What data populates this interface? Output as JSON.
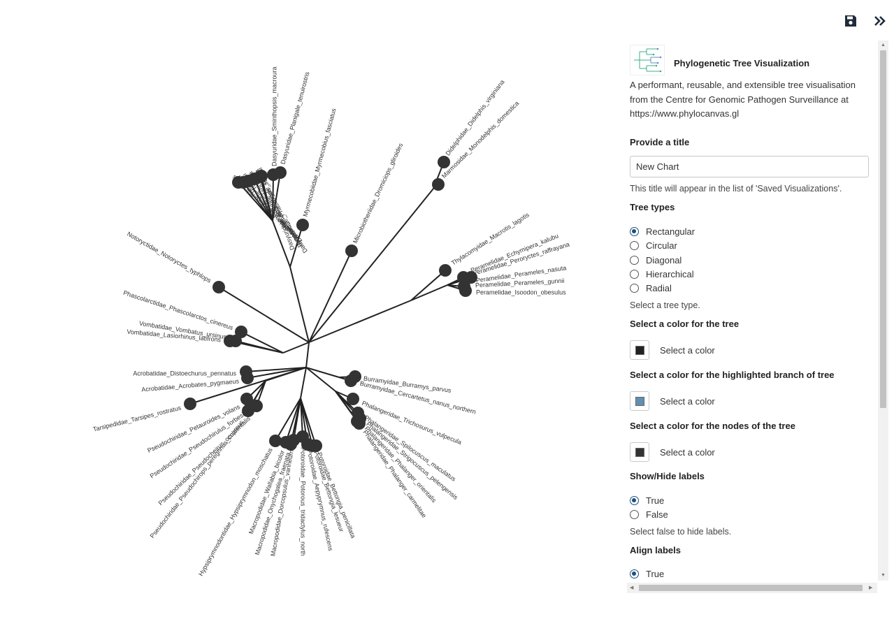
{
  "toolbar": {
    "save_icon": "save-icon",
    "collapse_icon": "chevrons-right-icon"
  },
  "colors": {
    "tree_color": "#222222",
    "highlight_color": "#5f90b4",
    "node_color": "#333333",
    "accent": "#1d4f7c"
  },
  "panel": {
    "title": "Phylogenetic Tree Visualization",
    "description": "A performant, reusable, and extensible tree visualisation from the Centre for Genomic Pathogen Surveillance at",
    "link": "https://www.phylocanvas.gl",
    "title_section": {
      "label": "Provide a title",
      "value": "New Chart",
      "hint": "This title will appear in the list of 'Saved Visualizations'."
    },
    "tree_types": {
      "label": "Tree types",
      "options": [
        "Rectangular",
        "Circular",
        "Diagonal",
        "Hierarchical",
        "Radial"
      ],
      "selected": "Rectangular",
      "hint": "Select a tree type."
    },
    "tree_color": {
      "label": "Select a color for the tree",
      "button": "Select a color"
    },
    "highlight_color": {
      "label": "Select a color for the highlighted branch of tree",
      "button": "Select a color"
    },
    "node_color": {
      "label": "Select a color for the nodes of the tree",
      "button": "Select a color"
    },
    "show_labels": {
      "label": "Show/Hide labels",
      "options": [
        "True",
        "False"
      ],
      "selected": "True",
      "hint": "Select false to hide labels."
    },
    "align_labels": {
      "label": "Align labels",
      "options": [
        "True"
      ],
      "selected": "True"
    }
  },
  "tree": {
    "leaves": [
      "Dasyuridae_Dasyurus_maculatus",
      "Dasyuridae_Dasyurus_geoffroii",
      "Dasyuridae_Sarcophilus_harrisii",
      "Dasyuridae_Phascogale_tapoatafa",
      "Dasyuridae_Phascogale_calura",
      "Dasyuridae_Antechinus_stuartii",
      "Dasyuridae_Sminthopsis_macroura",
      "Dasyuridae_Planigale_tenuirostris",
      "Myrmecobiidae_Myrmecobius_fasciatus",
      "Microbiotheriidae_Dromiciops_gliroides",
      "Didelphidae_Didelphis_virginiana",
      "Marmosidae_Monodelphis_domestica",
      "Thylacomyidae_Macrotis_lagotis",
      "Peramelidae_Echymipera_kalubu",
      "Peramelidae_Peroryctes_raffrayana",
      "Peramelidae_Perameles_nasuta",
      "Peramelidae_Perameles_gunnii",
      "Peramelidae_Isoodon_obesulus",
      "Notoryctidae_Notoryctes_typhlops",
      "Phascolarctidae_Phascolarctos_cinereus",
      "Vombatidae_Vombatus_ursinus",
      "Vombatidae_Lasiorhinus_latifrons",
      "Acrobatidae_Distoechurus_pennatus",
      "Acrobatidae_Acrobates_pygmaeus",
      "Tarsipedidae_Tarsipes_rostratus",
      "Pseudochiridae_Petauroides_volans",
      "Pseudochiridae_Pseudochirulus_forbesi",
      "Pseudochiridae_Pseudocheirus_occidentalis",
      "Pseudochiridae_Pseudochirops_peregrinus_cupreus",
      "Hypsiprymnodontidae_Hypsiprymnodon_moschatus",
      "Macropodidae_Wallabia_bicolor",
      "Macropodidae_Onychogalea_fraenata",
      "Macropodidae_Dorcopsulus_vanheurni",
      "Potoroidae_Potorous_tridactylus_north",
      "Potoroidae_Aepyprymnus_rufescens",
      "Potoroidae_Bettongia_lesueur",
      "Potoroidae_Bettongia_penicillata",
      "Burramyidae_Burramys_parvus",
      "Burramyidae_Cercartetus_nanus_northern",
      "Phalangeridae_Trichosurus_vulpecula",
      "Phalangeridae_Spilocuscus_maculatus",
      "Phalangeridae_Strigocuscus_pelengensis",
      "Phalangeridae_Phalanger_orientalis",
      "Phalangeridae_Phalanger_carmelitae"
    ]
  }
}
